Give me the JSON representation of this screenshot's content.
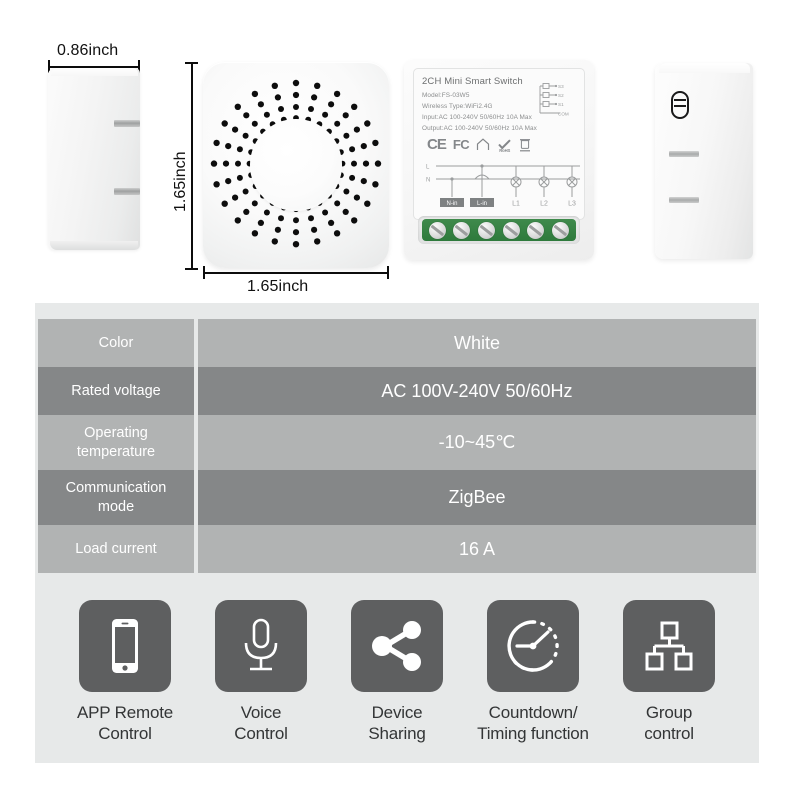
{
  "showcase": {
    "dimensions": {
      "width_side": "0.86inch",
      "height_top": "1.65inch",
      "width_top": "1.65inch"
    },
    "product_label": {
      "title": "2CH Mini Smart Switch",
      "model": "Model:FS-03W5",
      "wireless": "Wireless Type:WiFi2.4G",
      "input": "Input:AC 100-240V 50/60Hz 10A Max",
      "output": "Output:AC 100-240V 50/60Hz 10A Max",
      "certifications": [
        "CE",
        "FC",
        "house-mark",
        "RoHS",
        "WEEE"
      ],
      "rohs_text": "RoHS",
      "schematic_pins": [
        "S3",
        "S2",
        "S1",
        "COM"
      ],
      "wiring_terminals": [
        "N-in",
        "L-in",
        "L1",
        "L2",
        "L3"
      ],
      "wiring_rails": [
        "L",
        "N"
      ],
      "terminal_screw_count": 6
    }
  },
  "spec_table": {
    "rows": [
      {
        "key": "Color",
        "value": "White",
        "tone": "light"
      },
      {
        "key": "Rated voltage",
        "value": "AC  100V-240V 50/60Hz",
        "tone": "dark"
      },
      {
        "key": "Operating\ntemperature",
        "value": "-10~45℃",
        "tone": "light"
      },
      {
        "key": "Communication\nmode",
        "value": "ZigBee",
        "tone": "dark"
      },
      {
        "key": "Load current",
        "value": "16 A",
        "tone": "light"
      }
    ]
  },
  "features": [
    {
      "icon": "smartphone-icon",
      "label": "APP Remote\nControl"
    },
    {
      "icon": "microphone-icon",
      "label": "Voice\nControl"
    },
    {
      "icon": "share-nodes-icon",
      "label": "Device\nSharing"
    },
    {
      "icon": "countdown-clock-icon",
      "label": "Countdown/\nTiming function"
    },
    {
      "icon": "group-hierarchy-icon",
      "label": "Group\ncontrol"
    }
  ],
  "colors": {
    "page_background": "#ffffff",
    "panel_background": "#e7e9e9",
    "row_light": "#b1b3b3",
    "row_dark": "#858788",
    "row_text": "#ffffff",
    "feature_tile": "#5e5f60",
    "feature_label": "#333536",
    "dimension_line": "#0c0c0c",
    "terminal_green": "#337f42"
  }
}
